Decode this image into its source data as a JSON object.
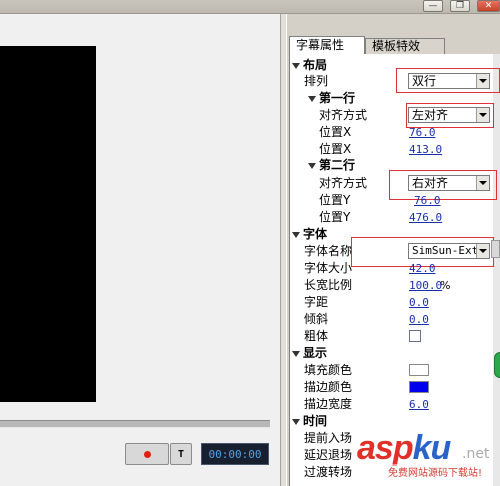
{
  "titlebar": {
    "buttons": [
      {
        "name": "minimize-button",
        "glyph": "—"
      },
      {
        "name": "maximize-button",
        "glyph": "❐"
      },
      {
        "name": "close-button",
        "glyph": "✕"
      }
    ]
  },
  "player": {
    "record_icon": "record-icon",
    "text_button_label": "T",
    "timecode": "00:00:00"
  },
  "tabs": [
    {
      "label": "字幕属性",
      "active": true
    },
    {
      "label": "模板特效",
      "active": false
    }
  ],
  "properties": {
    "layout": {
      "label": "布局",
      "arrangement": {
        "label": "排列",
        "value": "双行"
      },
      "line1": {
        "label": "第一行",
        "align": {
          "label": "对齐方式",
          "value": "左对齐"
        },
        "pos_x": {
          "label": "位置X",
          "value": "76.0"
        },
        "pos_x2": {
          "label": "位置X",
          "value": "413.0"
        }
      },
      "line2": {
        "label": "第二行",
        "align": {
          "label": "对齐方式",
          "value": "右对齐"
        },
        "pos_y": {
          "label": "位置Y",
          "value": "76.0"
        },
        "pos_y2": {
          "label": "位置Y",
          "value": "476.0"
        }
      }
    },
    "font": {
      "label": "字体",
      "name": {
        "label": "字体名称",
        "value": "SimSun-ExtB"
      },
      "size": {
        "label": "字体大小",
        "value": "42.0"
      },
      "aspect": {
        "label": "长宽比例",
        "value": "100.0",
        "unit": "%"
      },
      "spacing": {
        "label": "字距",
        "value": "0.0"
      },
      "slant": {
        "label": "倾斜",
        "value": "0.0"
      },
      "bold": {
        "label": "粗体",
        "checked": false
      }
    },
    "display": {
      "label": "显示",
      "fill_color": {
        "label": "填充颜色",
        "color": "#ffffff"
      },
      "stroke_color": {
        "label": "描边颜色",
        "color": "#0000ee"
      },
      "stroke_width": {
        "label": "描边宽度",
        "value": "6.0"
      }
    },
    "time": {
      "label": "时间",
      "lead_in": {
        "label": "提前入场"
      },
      "delay": {
        "label": "延迟退场"
      },
      "transition": {
        "label": "过渡转场"
      }
    }
  },
  "watermark": {
    "brand_a": "asp",
    "brand_b": "ku",
    "domain_suffix": ".net",
    "tagline": "免费网站源码下载站!"
  },
  "colors": {
    "highlight": "#e0303a",
    "value_text": "#1a2fb0",
    "timecode_text": "#4fa3e0"
  }
}
